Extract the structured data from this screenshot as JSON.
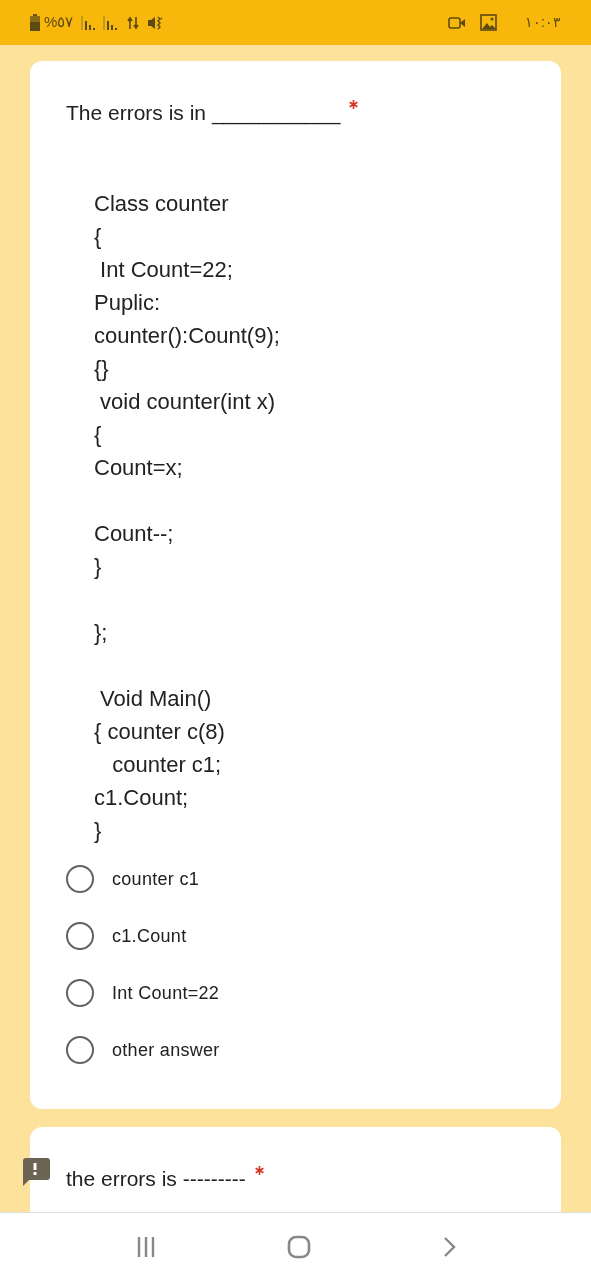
{
  "status_bar": {
    "battery": "%٥٧",
    "time": "١٠:٠٣"
  },
  "questions": [
    {
      "title": "The errors is in",
      "blank": "___________",
      "required": true,
      "code_blocks": [
        [
          "Class counter",
          "{",
          " Int Count=22;",
          "Puplic:",
          "counter():Count(9);",
          "{}",
          " void counter(int x)",
          "{",
          "Count=x;"
        ],
        [
          "Count--;",
          "}"
        ],
        [
          "};"
        ],
        [
          " Void Main()",
          "{ counter c(8)",
          "   counter c1;",
          "c1.Count;",
          "}"
        ]
      ],
      "options": [
        {
          "label": "counter c1",
          "selected": false
        },
        {
          "label": "c1.Count",
          "selected": false
        },
        {
          "label": "Int Count=22",
          "selected": false
        },
        {
          "label": "other answer",
          "selected": false
        }
      ]
    },
    {
      "title": "the errors is",
      "blank": "---------",
      "required": true
    }
  ]
}
